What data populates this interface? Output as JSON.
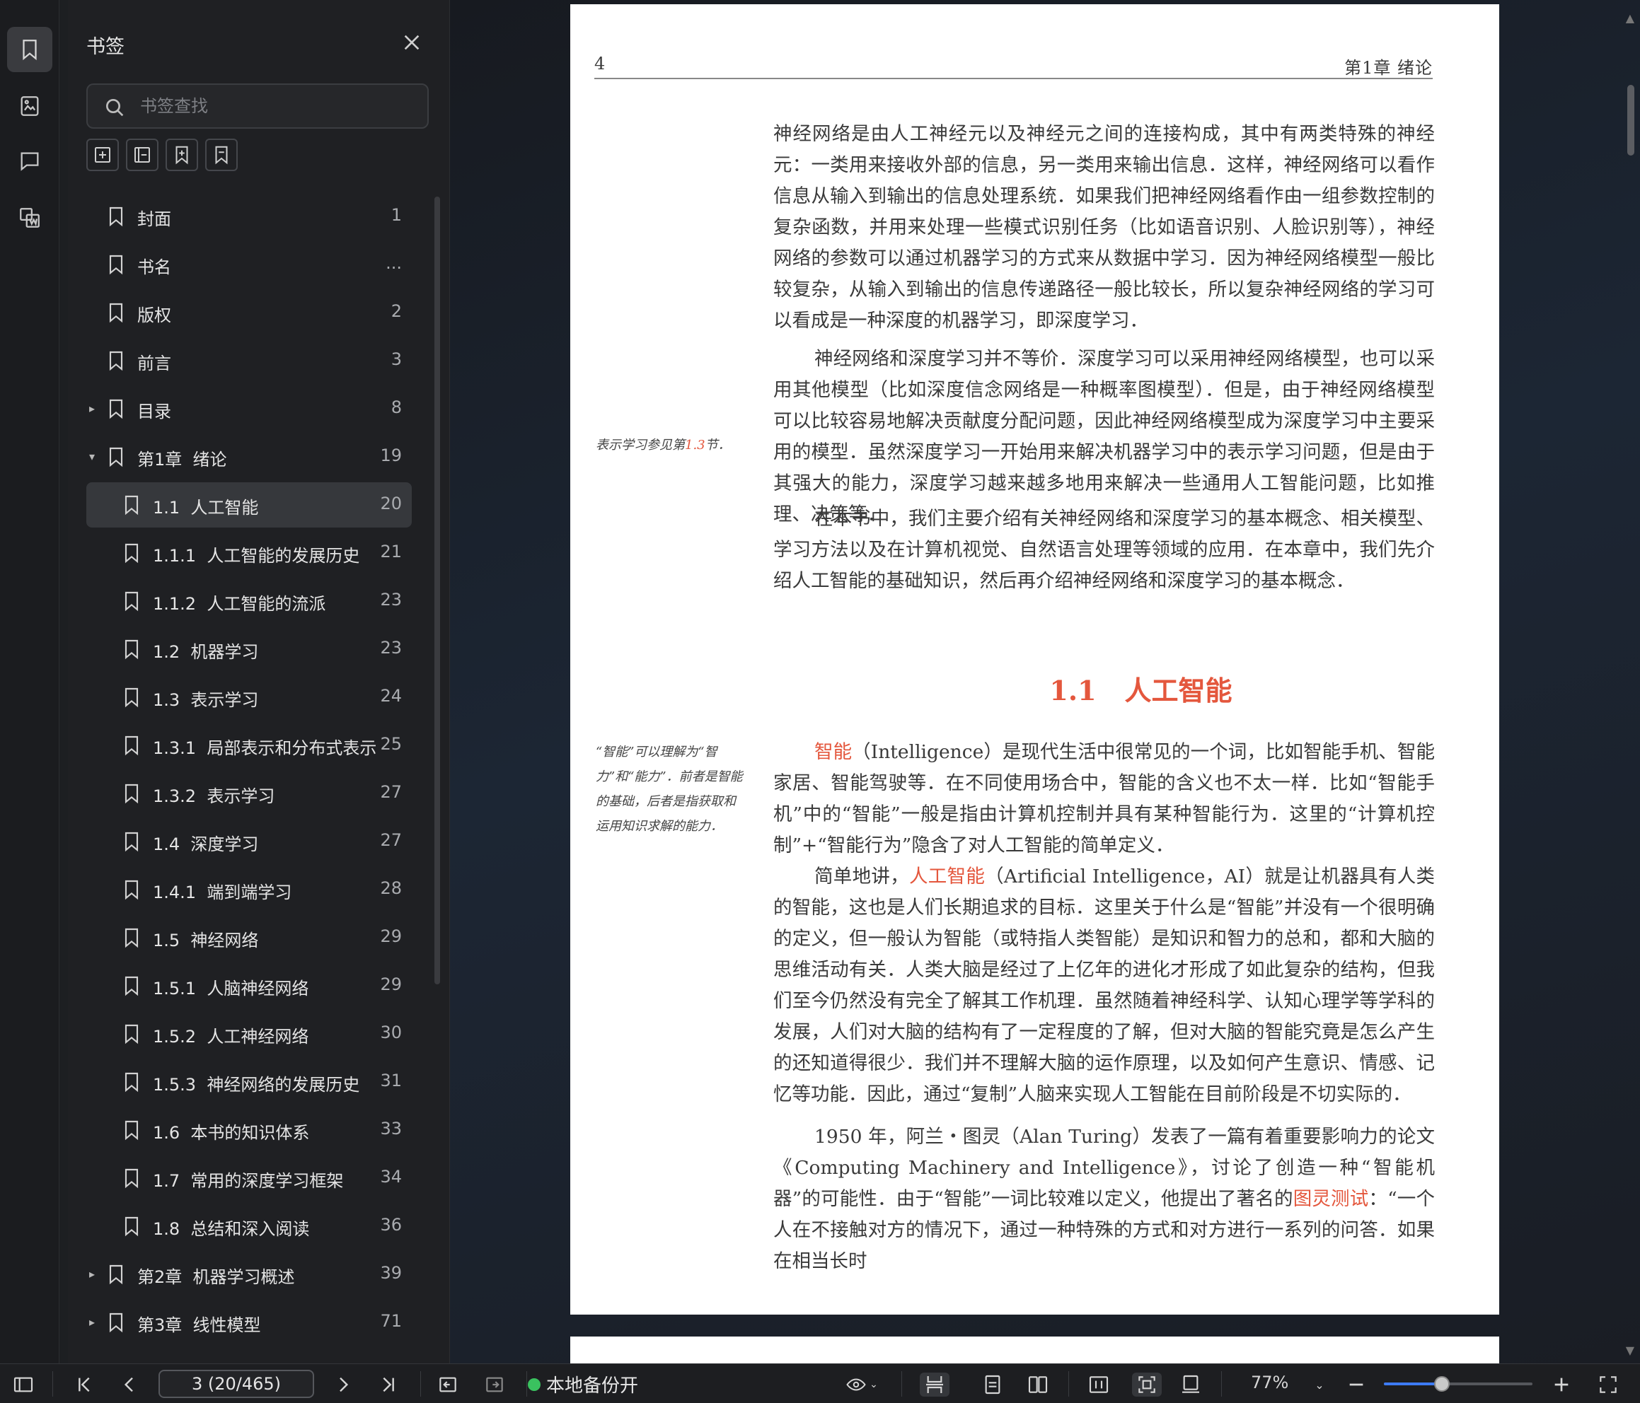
{
  "panel": {
    "title": "书签",
    "search_placeholder": "书签查找"
  },
  "bookmarks": [
    {
      "label": "封面",
      "page": "1",
      "level": 0,
      "expander": "none"
    },
    {
      "label": "书名",
      "page": "...",
      "level": 0,
      "expander": "none"
    },
    {
      "label": "版权",
      "page": "2",
      "level": 0,
      "expander": "none"
    },
    {
      "label": "前言",
      "page": "3",
      "level": 0,
      "expander": "none"
    },
    {
      "label": "目录",
      "page": "8",
      "level": 0,
      "expander": "collapsed"
    },
    {
      "label": "第1章  绪论",
      "page": "19",
      "level": 0,
      "expander": "expanded"
    },
    {
      "label": "1.1  人工智能",
      "page": "20",
      "level": 1,
      "expander": "none",
      "selected": true
    },
    {
      "label": "1.1.1  人工智能的发展历史",
      "page": "21",
      "level": 1,
      "expander": "none"
    },
    {
      "label": "1.1.2  人工智能的流派",
      "page": "23",
      "level": 1,
      "expander": "none"
    },
    {
      "label": "1.2  机器学习",
      "page": "23",
      "level": 1,
      "expander": "none"
    },
    {
      "label": "1.3  表示学习",
      "page": "24",
      "level": 1,
      "expander": "none"
    },
    {
      "label": "1.3.1  局部表示和分布式表示",
      "page": "25",
      "level": 1,
      "expander": "none"
    },
    {
      "label": "1.3.2  表示学习",
      "page": "27",
      "level": 1,
      "expander": "none"
    },
    {
      "label": "1.4  深度学习",
      "page": "27",
      "level": 1,
      "expander": "none"
    },
    {
      "label": "1.4.1  端到端学习",
      "page": "28",
      "level": 1,
      "expander": "none"
    },
    {
      "label": "1.5  神经网络",
      "page": "29",
      "level": 1,
      "expander": "none"
    },
    {
      "label": "1.5.1  人脑神经网络",
      "page": "29",
      "level": 1,
      "expander": "none"
    },
    {
      "label": "1.5.2  人工神经网络",
      "page": "30",
      "level": 1,
      "expander": "none"
    },
    {
      "label": "1.5.3  神经网络的发展历史",
      "page": "31",
      "level": 1,
      "expander": "none"
    },
    {
      "label": "1.6  本书的知识体系",
      "page": "33",
      "level": 1,
      "expander": "none"
    },
    {
      "label": "1.7  常用的深度学习框架",
      "page": "34",
      "level": 1,
      "expander": "none"
    },
    {
      "label": "1.8  总结和深入阅读",
      "page": "36",
      "level": 1,
      "expander": "none"
    },
    {
      "label": "第2章  机器学习概述",
      "page": "39",
      "level": 0,
      "expander": "collapsed"
    },
    {
      "label": "第3章  线性模型",
      "page": "71",
      "level": 0,
      "expander": "collapsed"
    }
  ],
  "document": {
    "page_number": "4",
    "running_header": "第1章   绪论",
    "para1": "神经网络是由人工神经元以及神经元之间的连接构成，其中有两类特殊的神经元：一类用来接收外部的信息，另一类用来输出信息．这样，神经网络可以看作信息从输入到输出的信息处理系统．如果我们把神经网络看作由一组参数控制的复杂函数，并用来处理一些模式识别任务（比如语音识别、人脸识别等），神经网络的参数可以通过机器学习的方式来从数据中学习．因为神经网络模型一般比较复杂，从输入到输出的信息传递路径一般比较长，所以复杂神经网络的学习可以看成是一种深度的机器学习，即深度学习．",
    "para2": "神经网络和深度学习并不等价．深度学习可以采用神经网络模型，也可以采用其他模型（比如深度信念网络是一种概率图模型）．但是，由于神经网络模型可以比较容易地解决贡献度分配问题，因此神经网络模型成为深度学习中主要采用的模型．虽然深度学习一开始用来解决机器学习中的表示学习问题，但是由于其强大的能力，深度学习越来越多地用来解决一些通用人工智能问题，比如推理、决策等．",
    "para3": "在本书中，我们主要介绍有关神经网络和深度学习的基本概念、相关模型、学习方法以及在计算机视觉、自然语言处理等领域的应用．在本章中，我们先介绍人工智能的基础知识，然后再介绍神经网络和深度学习的基本概念．",
    "note1_prefix": "表示学习参见第",
    "note1_ref": "1.3",
    "note1_suffix": "节．",
    "section_number": "1.1",
    "section_title": "人工智能",
    "para4_term": "智能",
    "para4_rest": "（Intelligence）是现代生活中很常见的一个词，比如智能手机、智能家居、智能驾驶等．在不同使用场合中，智能的含义也不太一样．比如“智能手机”中的“智能”一般是指由计算机控制并具有某种智能行为．这里的“计算机控制”+“智能行为”隐含了对人工智能的简单定义．",
    "note2": "“智能”可以理解为“智力”和“能力”．前者是智能的基础，后者是指获取和运用知识求解的能力．",
    "para5_a": "简单地讲，",
    "para5_term": "人工智能",
    "para5_b": "（Artificial Intelligence，AI）就是让机器具有人类的智能，这也是人们长期追求的目标．这里关于什么是“智能”并没有一个很明确的定义，但一般认为智能（或特指人类智能）是知识和智力的总和，都和大脑的思维活动有关．人类大脑是经过了上亿年的进化才形成了如此复杂的结构，但我们至今仍然没有完全了解其工作机理．虽然随着神经科学、认知心理学等学科的发展，人们对大脑的结构有了一定程度的了解，但对大脑的智能究竟是怎么产生的还知道得很少．我们并不理解大脑的运作原理，以及如何产生意识、情感、记忆等功能．因此，通过“复制”人脑来实现人工智能在目前阶段是不切实际的．",
    "para6_a": "1950 年，阿兰・图灵（Alan Turing）发表了一篇有着重要影响力的论文《Computing Machinery and Intelligence》，讨论了创造一种“智能机器”的可能性．由于“智能”一词比较难以定义，他提出了著名的",
    "para6_term": "图灵测试",
    "para6_b": "：“一个人在不接触对方的情况下，通过一种特殊的方式和对方进行一系列的问答．如果在相当长时"
  },
  "toolbar": {
    "page_indicator": "3 (20/465)",
    "backup_label": "本地备份开",
    "zoom_label": "77%",
    "zoom_fraction": 0.39
  },
  "colors": {
    "accent_red": "#e4573d",
    "backup_green": "#3ac25f",
    "slider_blue": "#3d7bf4"
  },
  "icons": {
    "rail": [
      "bookmark-icon",
      "thumbnail-icon",
      "comment-icon",
      "extract-icon"
    ],
    "tools": [
      "add-bookmark-icon",
      "add-child-bookmark-icon",
      "bookmark-plus-icon",
      "bookmark-remove-icon"
    ]
  }
}
